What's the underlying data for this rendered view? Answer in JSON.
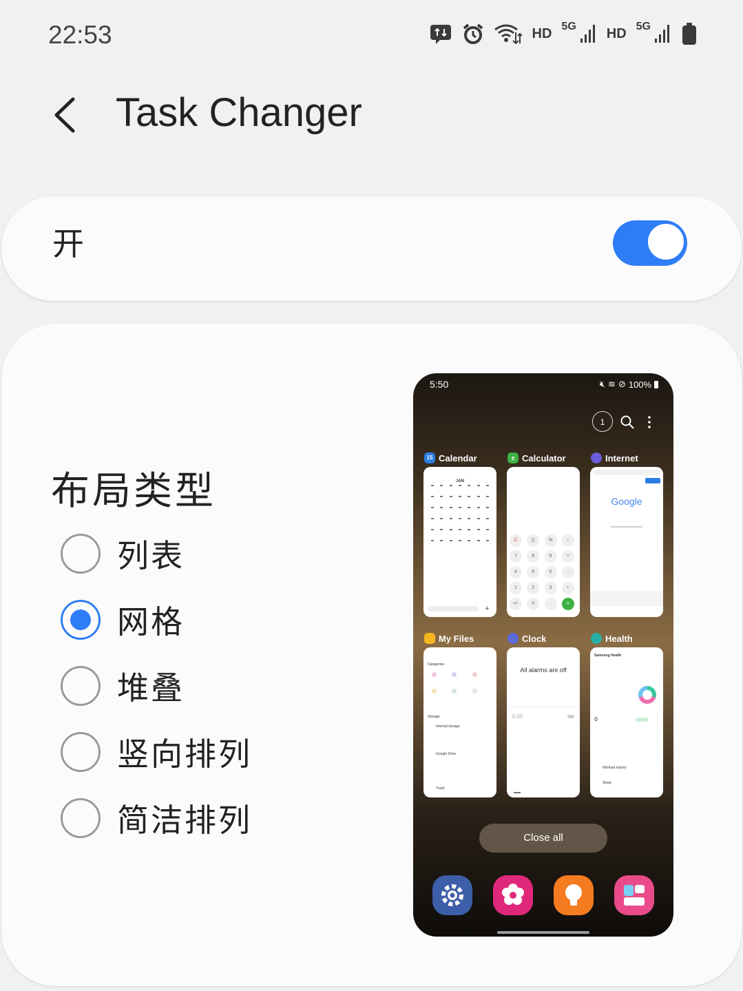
{
  "status_bar": {
    "time": "22:53",
    "hd1": "HD",
    "hd2": "HD",
    "sig1": "5G",
    "sig2": "5G"
  },
  "header": {
    "title": "Task Changer",
    "back_icon": "chevron-left-icon"
  },
  "toggle_card": {
    "label": "开",
    "enabled": true,
    "accent_color": "#2f7df6"
  },
  "layout_section": {
    "title": "布局类型",
    "options": [
      {
        "label": "列表",
        "selected": false
      },
      {
        "label": "网格",
        "selected": true
      },
      {
        "label": "堆叠",
        "selected": false
      },
      {
        "label": "竖向排列",
        "selected": false
      },
      {
        "label": "简洁排列",
        "selected": false
      }
    ]
  },
  "preview": {
    "time": "5:50",
    "battery": "100%",
    "page_counter": "1",
    "apps": [
      {
        "name": "Calendar",
        "icon_color": "#2a7de1",
        "icon_text": "15"
      },
      {
        "name": "Calculator",
        "icon_color": "#3cb043",
        "icon_text": "±"
      },
      {
        "name": "Internet",
        "icon_color": "#6a5cd8",
        "icon_text": ""
      },
      {
        "name": "My Files",
        "icon_color": "#f7b520",
        "icon_text": ""
      },
      {
        "name": "Clock",
        "icon_color": "#5a6ad8",
        "icon_text": ""
      },
      {
        "name": "Health",
        "icon_color": "#25b0a5",
        "icon_text": ""
      }
    ],
    "calendar_month": "JAN",
    "internet_logo": "Google",
    "clock_text": "All alarms are off",
    "clock_time": "0:00",
    "health_title": "Samsung Health",
    "files_categories": "Categories",
    "files_storage": "Storage",
    "files_internal": "Internal storage",
    "files_gdrive": "Google Drive",
    "files_trash": "Trash",
    "health_workout": "Workout history",
    "health_sleep": "Sleep",
    "calc_keys": [
      "C",
      "()",
      "%",
      "÷",
      "7",
      "8",
      "9",
      "×",
      "4",
      "5",
      "6",
      "−",
      "1",
      "2",
      "3",
      "+",
      "+/-",
      "0",
      ".",
      "="
    ],
    "close_all": "Close all",
    "dock": [
      {
        "name": "settings-app-icon",
        "color": "#3d5ea8"
      },
      {
        "name": "gallery-app-icon",
        "color": "#e0287a"
      },
      {
        "name": "tips-app-icon",
        "color": "#f47b20"
      },
      {
        "name": "store-app-icon",
        "color": "#e94b8a"
      }
    ]
  }
}
